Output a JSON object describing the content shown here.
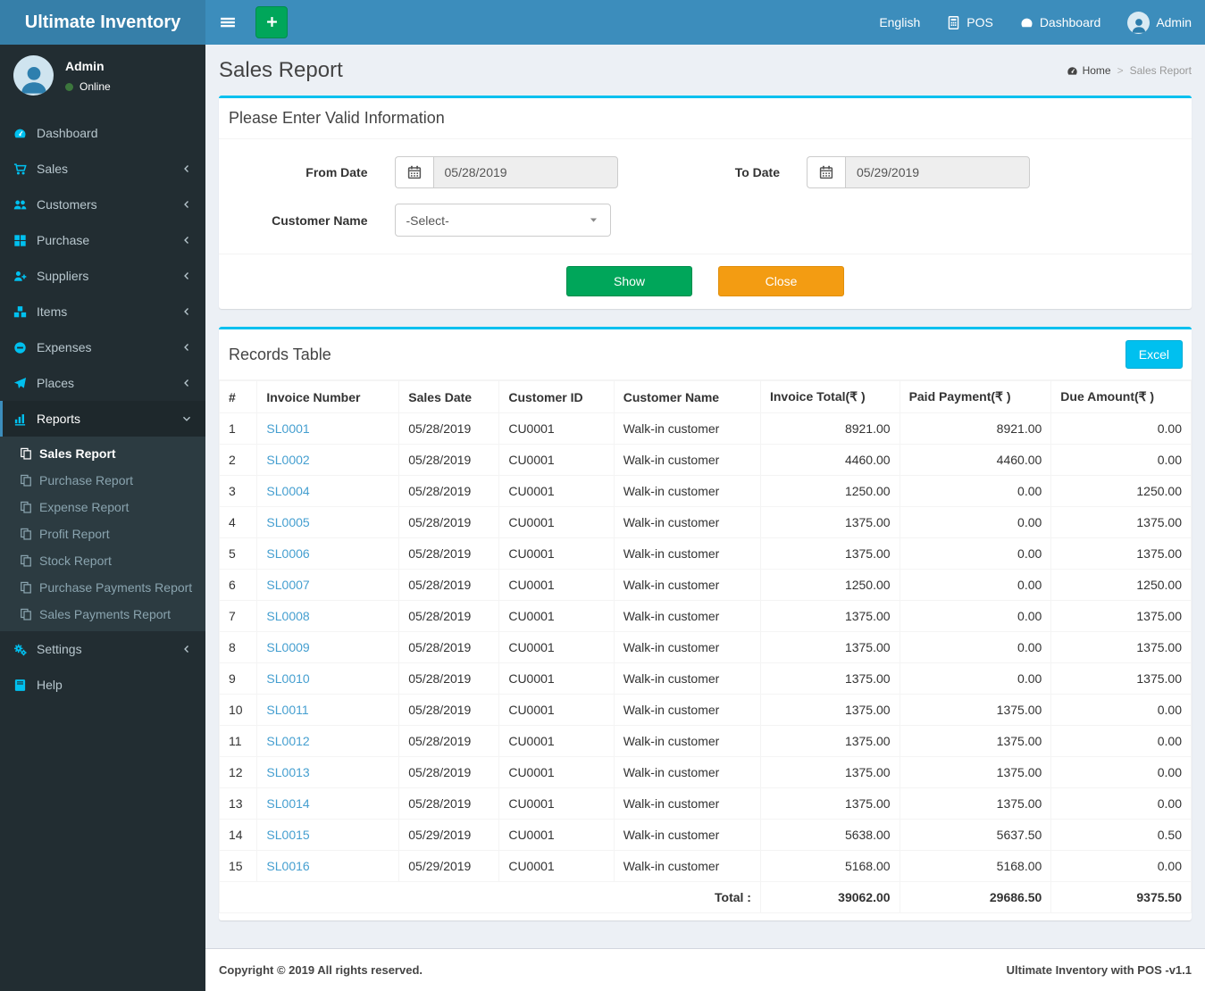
{
  "app": {
    "title": "Ultimate Inventory",
    "copyright": "Copyright © 2019 All rights reserved.",
    "version_label": "Ultimate Inventory with POS -v1.1"
  },
  "colors": {
    "navbar": "#3c8dbc",
    "logo_bg": "#367fa9",
    "sidebar": "#222d32",
    "accent": "#00c0ef",
    "green": "#00a65a",
    "orange": "#f39c12",
    "link": "#459fd0"
  },
  "topbar": {
    "items": [
      {
        "icon": "",
        "label": "English"
      },
      {
        "icon": "calculator",
        "label": "POS"
      },
      {
        "icon": "gauge",
        "label": "Dashboard"
      },
      {
        "icon": "person",
        "label": "Admin",
        "avatar": true
      }
    ]
  },
  "sidebar": {
    "user": {
      "name": "Admin",
      "status": "Online"
    },
    "items": [
      {
        "icon": "gauge",
        "label": "Dashboard"
      },
      {
        "icon": "cart",
        "label": "Sales",
        "chevron": "left"
      },
      {
        "icon": "users",
        "label": "Customers",
        "chevron": "left"
      },
      {
        "icon": "th",
        "label": "Purchase",
        "chevron": "left"
      },
      {
        "icon": "user-plus",
        "label": "Suppliers",
        "chevron": "left"
      },
      {
        "icon": "cubes",
        "label": "Items",
        "chevron": "left"
      },
      {
        "icon": "minus-circle",
        "label": "Expenses",
        "chevron": "left"
      },
      {
        "icon": "paper-plane",
        "label": "Places",
        "chevron": "left"
      },
      {
        "icon": "bar-chart",
        "label": "Reports",
        "chevron": "down",
        "active": true,
        "submenu": [
          {
            "icon": "copy",
            "label": "Sales Report",
            "active": true
          },
          {
            "icon": "copy",
            "label": "Purchase Report"
          },
          {
            "icon": "copy",
            "label": "Expense Report"
          },
          {
            "icon": "copy",
            "label": "Profit Report"
          },
          {
            "icon": "copy",
            "label": "Stock Report"
          },
          {
            "icon": "copy",
            "label": "Purchase Payments Report"
          },
          {
            "icon": "copy",
            "label": "Sales Payments Report"
          }
        ]
      },
      {
        "icon": "gears",
        "label": "Settings",
        "chevron": "left"
      },
      {
        "icon": "book",
        "label": "Help"
      }
    ]
  },
  "page": {
    "title": "Sales Report",
    "breadcrumb": {
      "home": "Home",
      "separator": ">",
      "current": "Sales Report"
    }
  },
  "filter_panel": {
    "title": "Please Enter Valid Information",
    "from_date_label": "From Date",
    "from_date_value": "05/28/2019",
    "to_date_label": "To Date",
    "to_date_value": "05/29/2019",
    "customer_label": "Customer Name",
    "customer_value": "-Select-",
    "show_label": "Show",
    "close_label": "Close"
  },
  "records": {
    "title": "Records Table",
    "excel_label": "Excel",
    "columns": [
      "#",
      "Invoice Number",
      "Sales Date",
      "Customer ID",
      "Customer Name",
      "Invoice Total(₹ )",
      "Paid Payment(₹ )",
      "Due Amount(₹ )"
    ],
    "rows": [
      [
        "1",
        "SL0001",
        "05/28/2019",
        "CU0001",
        "Walk-in customer",
        "8921.00",
        "8921.00",
        "0.00"
      ],
      [
        "2",
        "SL0002",
        "05/28/2019",
        "CU0001",
        "Walk-in customer",
        "4460.00",
        "4460.00",
        "0.00"
      ],
      [
        "3",
        "SL0004",
        "05/28/2019",
        "CU0001",
        "Walk-in customer",
        "1250.00",
        "0.00",
        "1250.00"
      ],
      [
        "4",
        "SL0005",
        "05/28/2019",
        "CU0001",
        "Walk-in customer",
        "1375.00",
        "0.00",
        "1375.00"
      ],
      [
        "5",
        "SL0006",
        "05/28/2019",
        "CU0001",
        "Walk-in customer",
        "1375.00",
        "0.00",
        "1375.00"
      ],
      [
        "6",
        "SL0007",
        "05/28/2019",
        "CU0001",
        "Walk-in customer",
        "1250.00",
        "0.00",
        "1250.00"
      ],
      [
        "7",
        "SL0008",
        "05/28/2019",
        "CU0001",
        "Walk-in customer",
        "1375.00",
        "0.00",
        "1375.00"
      ],
      [
        "8",
        "SL0009",
        "05/28/2019",
        "CU0001",
        "Walk-in customer",
        "1375.00",
        "0.00",
        "1375.00"
      ],
      [
        "9",
        "SL0010",
        "05/28/2019",
        "CU0001",
        "Walk-in customer",
        "1375.00",
        "0.00",
        "1375.00"
      ],
      [
        "10",
        "SL0011",
        "05/28/2019",
        "CU0001",
        "Walk-in customer",
        "1375.00",
        "1375.00",
        "0.00"
      ],
      [
        "11",
        "SL0012",
        "05/28/2019",
        "CU0001",
        "Walk-in customer",
        "1375.00",
        "1375.00",
        "0.00"
      ],
      [
        "12",
        "SL0013",
        "05/28/2019",
        "CU0001",
        "Walk-in customer",
        "1375.00",
        "1375.00",
        "0.00"
      ],
      [
        "13",
        "SL0014",
        "05/28/2019",
        "CU0001",
        "Walk-in customer",
        "1375.00",
        "1375.00",
        "0.00"
      ],
      [
        "14",
        "SL0015",
        "05/29/2019",
        "CU0001",
        "Walk-in customer",
        "5638.00",
        "5637.50",
        "0.50"
      ],
      [
        "15",
        "SL0016",
        "05/29/2019",
        "CU0001",
        "Walk-in customer",
        "5168.00",
        "5168.00",
        "0.00"
      ]
    ],
    "total_label": "Total :",
    "totals": [
      "39062.00",
      "29686.50",
      "9375.50"
    ]
  }
}
